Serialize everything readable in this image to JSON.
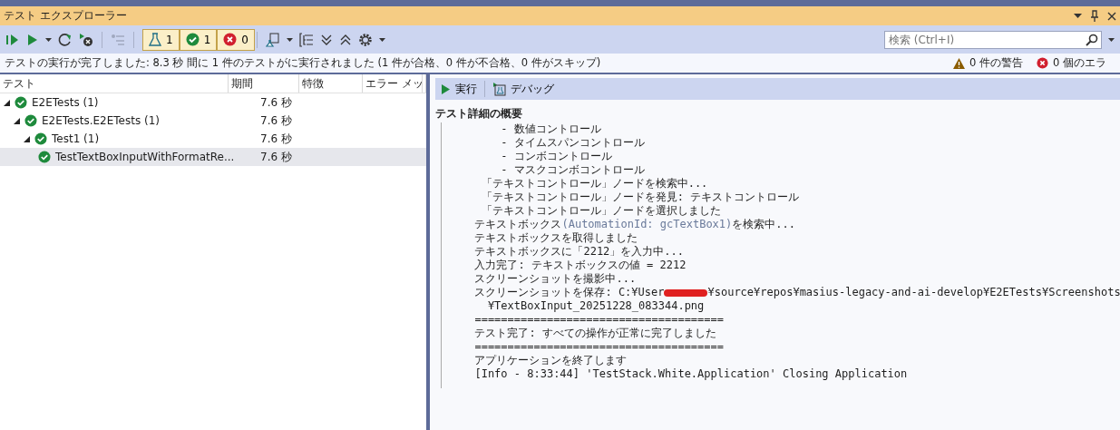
{
  "window": {
    "title": "テスト エクスプローラー"
  },
  "toolbar": {
    "filters": [
      {
        "kind": "total",
        "count": "1",
        "selected": true
      },
      {
        "kind": "passed",
        "count": "1",
        "selected": true
      },
      {
        "kind": "failed",
        "count": "0",
        "selected": true
      }
    ]
  },
  "search": {
    "placeholder": "検索 (Ctrl+I)"
  },
  "summary": {
    "text": "テストの実行が完了しました: 8.3 秒 間に 1 件のテストがに実行されました (1 件が合格、0 件が不合格、0 件がスキップ)",
    "warnings": "0 件の警告",
    "errors": "0 個のエラ"
  },
  "table": {
    "columns": [
      "テスト",
      "期間",
      "特徴",
      "エラー メッ"
    ],
    "tree": [
      {
        "name": "E2ETests (1)",
        "duration": "7.6 秒",
        "expanded": true,
        "selected": false,
        "children": [
          {
            "name": "E2ETests.E2ETests (1)",
            "duration": "7.6 秒",
            "expanded": true,
            "selected": false,
            "children": [
              {
                "name": "Test1 (1)",
                "duration": "7.6 秒",
                "expanded": true,
                "selected": false,
                "children": [
                  {
                    "name": "TestTextBoxInputWithFormatRe...",
                    "duration": "7.6 秒",
                    "selected": true
                  }
                ]
              }
            ]
          }
        ]
      }
    ]
  },
  "details": {
    "actions": [
      {
        "kind": "run",
        "label": "実行"
      },
      {
        "kind": "debug",
        "label": "デバッグ"
      }
    ],
    "heading": "テスト詳細の概要",
    "lines": [
      {
        "kind": "text",
        "text": "      - 数値コントロール"
      },
      {
        "kind": "text",
        "text": "      - タイムスパンコントロール"
      },
      {
        "kind": "text",
        "text": "      - コンボコントロール"
      },
      {
        "kind": "text",
        "text": "      - マスクコンボコントロール"
      },
      {
        "kind": "text",
        "text": "   「テキストコントロール」ノードを検索中..."
      },
      {
        "kind": "text",
        "text": "   「テキストコントロール」ノードを発見: テキストコントロール"
      },
      {
        "kind": "text",
        "text": "   「テキストコントロール」ノードを選択しました"
      },
      {
        "kind": "parts",
        "parts": [
          {
            "text": "  テキストボックス",
            "dim": false
          },
          {
            "text": "(AutomationId: gcTextBox1)",
            "dim": true
          },
          {
            "text": "を検索中...",
            "dim": false
          }
        ]
      },
      {
        "kind": "text",
        "text": "  テキストボックスを取得しました"
      },
      {
        "kind": "text",
        "text": "  テキストボックスに「2212」を入力中..."
      },
      {
        "kind": "text",
        "text": "  入力完了: テキストボックスの値 = 2212"
      },
      {
        "kind": "text",
        "text": "  スクリーンショットを撮影中..."
      },
      {
        "kind": "redacted",
        "before": "  スクリーンショットを保存: C:¥User",
        "after": "¥source¥repos¥masius-legacy-and-ai-develop¥E2ETests¥Screenshots"
      },
      {
        "kind": "text",
        "text": "    ¥TextBoxInput_20251228_083344.png"
      },
      {
        "kind": "text",
        "text": "  ======================================"
      },
      {
        "kind": "text",
        "text": "  テスト完了: すべての操作が正常に完了しました"
      },
      {
        "kind": "text",
        "text": "  ======================================"
      },
      {
        "kind": "text",
        "text": "  アプリケーションを終了します"
      },
      {
        "kind": "text",
        "text": "  [Info - 8:33:44] 'TestStack.White.Application' Closing Application"
      }
    ]
  }
}
